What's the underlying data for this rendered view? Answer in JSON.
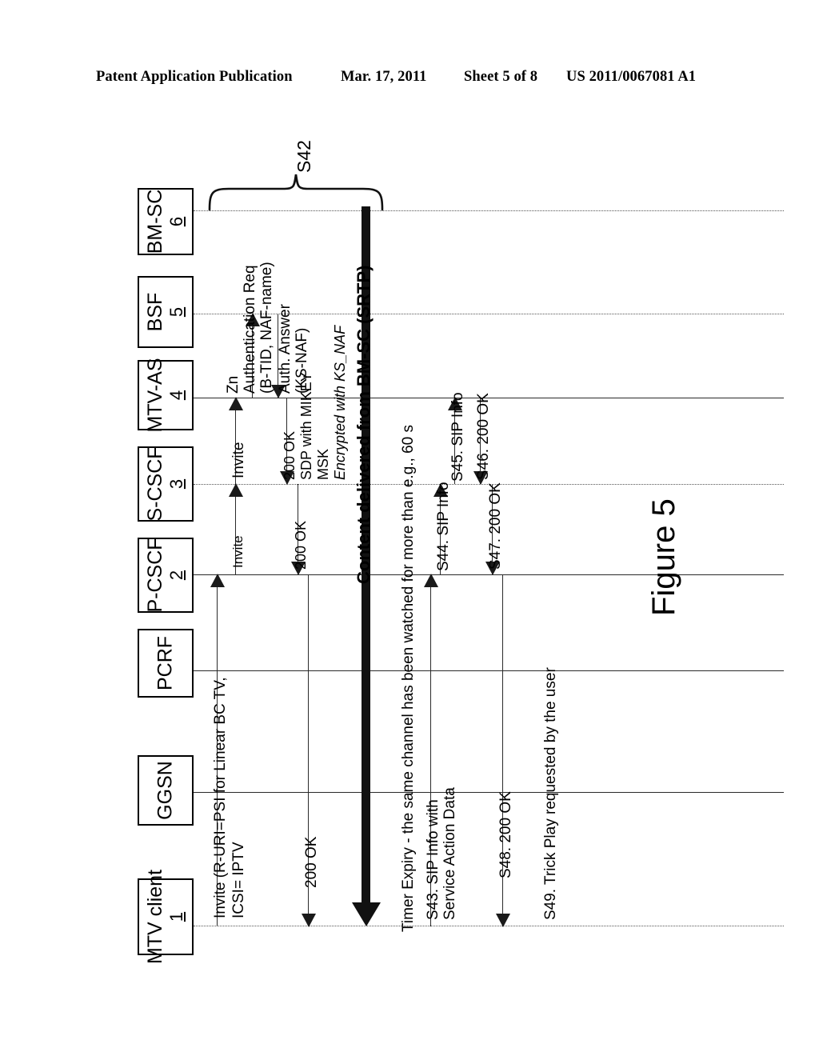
{
  "header": {
    "publication": "Patent Application Publication",
    "date": "Mar. 17, 2011",
    "sheet": "Sheet 5 of 8",
    "number": "US 2011/0067081 A1"
  },
  "figure": {
    "caption": "Figure 5",
    "group_label": "S42"
  },
  "participants": [
    {
      "name": "BM-SC",
      "ref": "6"
    },
    {
      "name": "BSF",
      "ref": "5"
    },
    {
      "name": "MTV-AS",
      "ref": "4"
    },
    {
      "name": "S-CSCF",
      "ref": "3"
    },
    {
      "name": "P-CSCF",
      "ref": "2"
    },
    {
      "name": "PCRF",
      "ref": ""
    },
    {
      "name": "GGSN",
      "ref": ""
    },
    {
      "name": "MTV client",
      "ref": "1"
    }
  ],
  "messages": {
    "invite_client": "Invite  (R-URI=PSI for Linear BC TV,",
    "invite_client_line2": "ICSI= IPTV",
    "invite_pcscf": "Invite",
    "invite_scscf": "Invite",
    "zn_auth_req_line1": "Zn",
    "zn_auth_req_line2": "Authentication Req",
    "zn_auth_req_line3": "(B-TID, NAF-name)",
    "auth_answer_line1": "Auth. Answer",
    "auth_answer_line2": "(KS-NAF)",
    "ok_mtvas_line1": "200 OK",
    "ok_mtvas_line2": "SDP with MIKEY",
    "ok_mtvas_line3": "MSK",
    "ok_mtvas_line4": "Encrypted with KS_NAF",
    "ok_scscf": "200 OK",
    "ok_pcscf": "200 OK",
    "content_delivery": "Content delivered from BM-SC (SRTP)",
    "timer_expiry": "Timer Expiry - the same channel has been watched for more than e.g., 60 s",
    "s43_line1": "S43. SIP Info  with",
    "s43_line2": "Service Action Data",
    "s44": "S44. SIP Info",
    "s45": "S45. SIP Info",
    "s46": "S46. 200 OK",
    "s47": "S47. 200 OK",
    "s48": "S48. 200 OK",
    "s49": "S49. Trick Play requested by the user"
  },
  "colors": {
    "ink": "#000000",
    "line": "#2a2a2a",
    "dotted": "#555555"
  }
}
